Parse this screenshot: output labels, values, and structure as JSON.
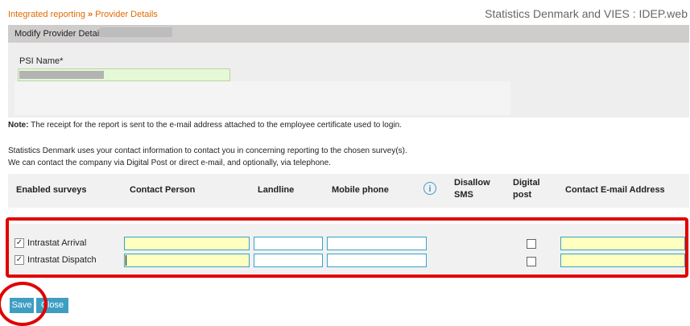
{
  "breadcrumb": {
    "root": "Integrated reporting",
    "separator": "»",
    "current": "Provider Details"
  },
  "app_title": "Statistics Denmark and VIES : IDEP.web",
  "panel": {
    "title": "Modify Provider Details"
  },
  "psi": {
    "label": "PSI Name*"
  },
  "note": {
    "prefix": "Note:",
    "text": " The receipt for the report is sent to the e-mail address attached to the employee certificate used to login."
  },
  "info": {
    "line1": "Statistics Denmark uses your contact information to contact you in concerning reporting to the chosen survey(s).",
    "line2": "We can contact the company via Digital Post or direct e-mail, and optionally, via telephone."
  },
  "table": {
    "headers": {
      "enabled": "Enabled surveys",
      "contact": "Contact Person",
      "landline": "Landline",
      "mobile": "Mobile phone",
      "info_icon": "i",
      "disallow_line1": "Disallow",
      "disallow_line2": "SMS",
      "digital_line1": "Digital",
      "digital_line2": "post",
      "email": "Contact E-mail Address"
    },
    "rows": [
      {
        "label": "Intrastat Arrival",
        "checked": "✓"
      },
      {
        "label": "Intrastat Dispatch",
        "checked": "✓"
      }
    ]
  },
  "buttons": {
    "save": "Save",
    "close": "Close"
  },
  "annotation_color": "#e00000",
  "accent_color": "#3e9ec2"
}
